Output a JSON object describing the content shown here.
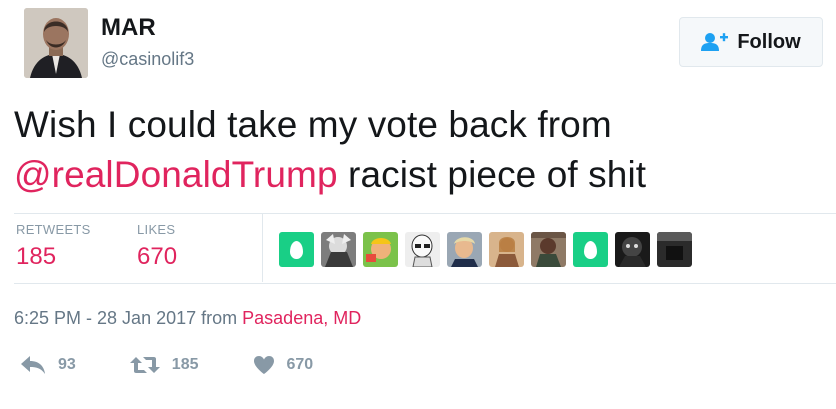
{
  "user": {
    "name": "MAR",
    "handle": "@casinolif3"
  },
  "follow_button": {
    "label": "Follow",
    "icon": "add-user-icon"
  },
  "tweet": {
    "text_line1": "Wish I could take my vote back from",
    "mention": "@realDonaldTrump",
    "text_line2_rest": " racist piece of shit"
  },
  "stats": {
    "retweets_label": "RETWEETS",
    "retweets_value": "185",
    "likes_label": "LIKES",
    "likes_value": "670"
  },
  "liked_by": [
    "egg-avatar",
    "avatar",
    "avatar",
    "avatar",
    "avatar",
    "avatar",
    "avatar",
    "egg-avatar",
    "avatar",
    "avatar"
  ],
  "meta": {
    "timestamp": "6:25 PM - 28 Jan 2017",
    "from_label": "from",
    "location": "Pasadena, MD"
  },
  "actions": {
    "reply_count": "93",
    "retweet_count": "185",
    "like_count": "670"
  },
  "colors": {
    "accent": "#e0245e",
    "follow_icon": "#1da1f2",
    "muted": "#8899a6",
    "egg": "#19cf86"
  }
}
